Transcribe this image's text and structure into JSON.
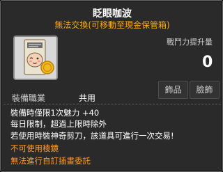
{
  "item": {
    "name": "眨眼咖波",
    "trade_note": "無法交換(可移動至現金保管箱)",
    "combat_power_label": "戰鬥力提升量",
    "combat_power_value": "0",
    "equip_job_label": "裝備職業",
    "equip_job_value": "共用",
    "type_buttons": [
      "飾品",
      "臉飾"
    ],
    "stats": {
      "label": "裝備時僅限1次魅力",
      "value": "+40"
    },
    "limit_line": "每日限制，超過上限時除外",
    "scissors_line": "若使用時裝神奇剪刀，該道具可進行一次交易!",
    "warning_1": "不可使用稜鏡",
    "warning_2": "無法進行自訂插畫委託"
  },
  "colors": {
    "background": "#2a2a2b",
    "title": "#ffffff",
    "trade_note": "#ffaa11",
    "warning": "#ff9a22"
  },
  "icon": "ticket-with-smiling-seal-and-gold-coin-icon"
}
